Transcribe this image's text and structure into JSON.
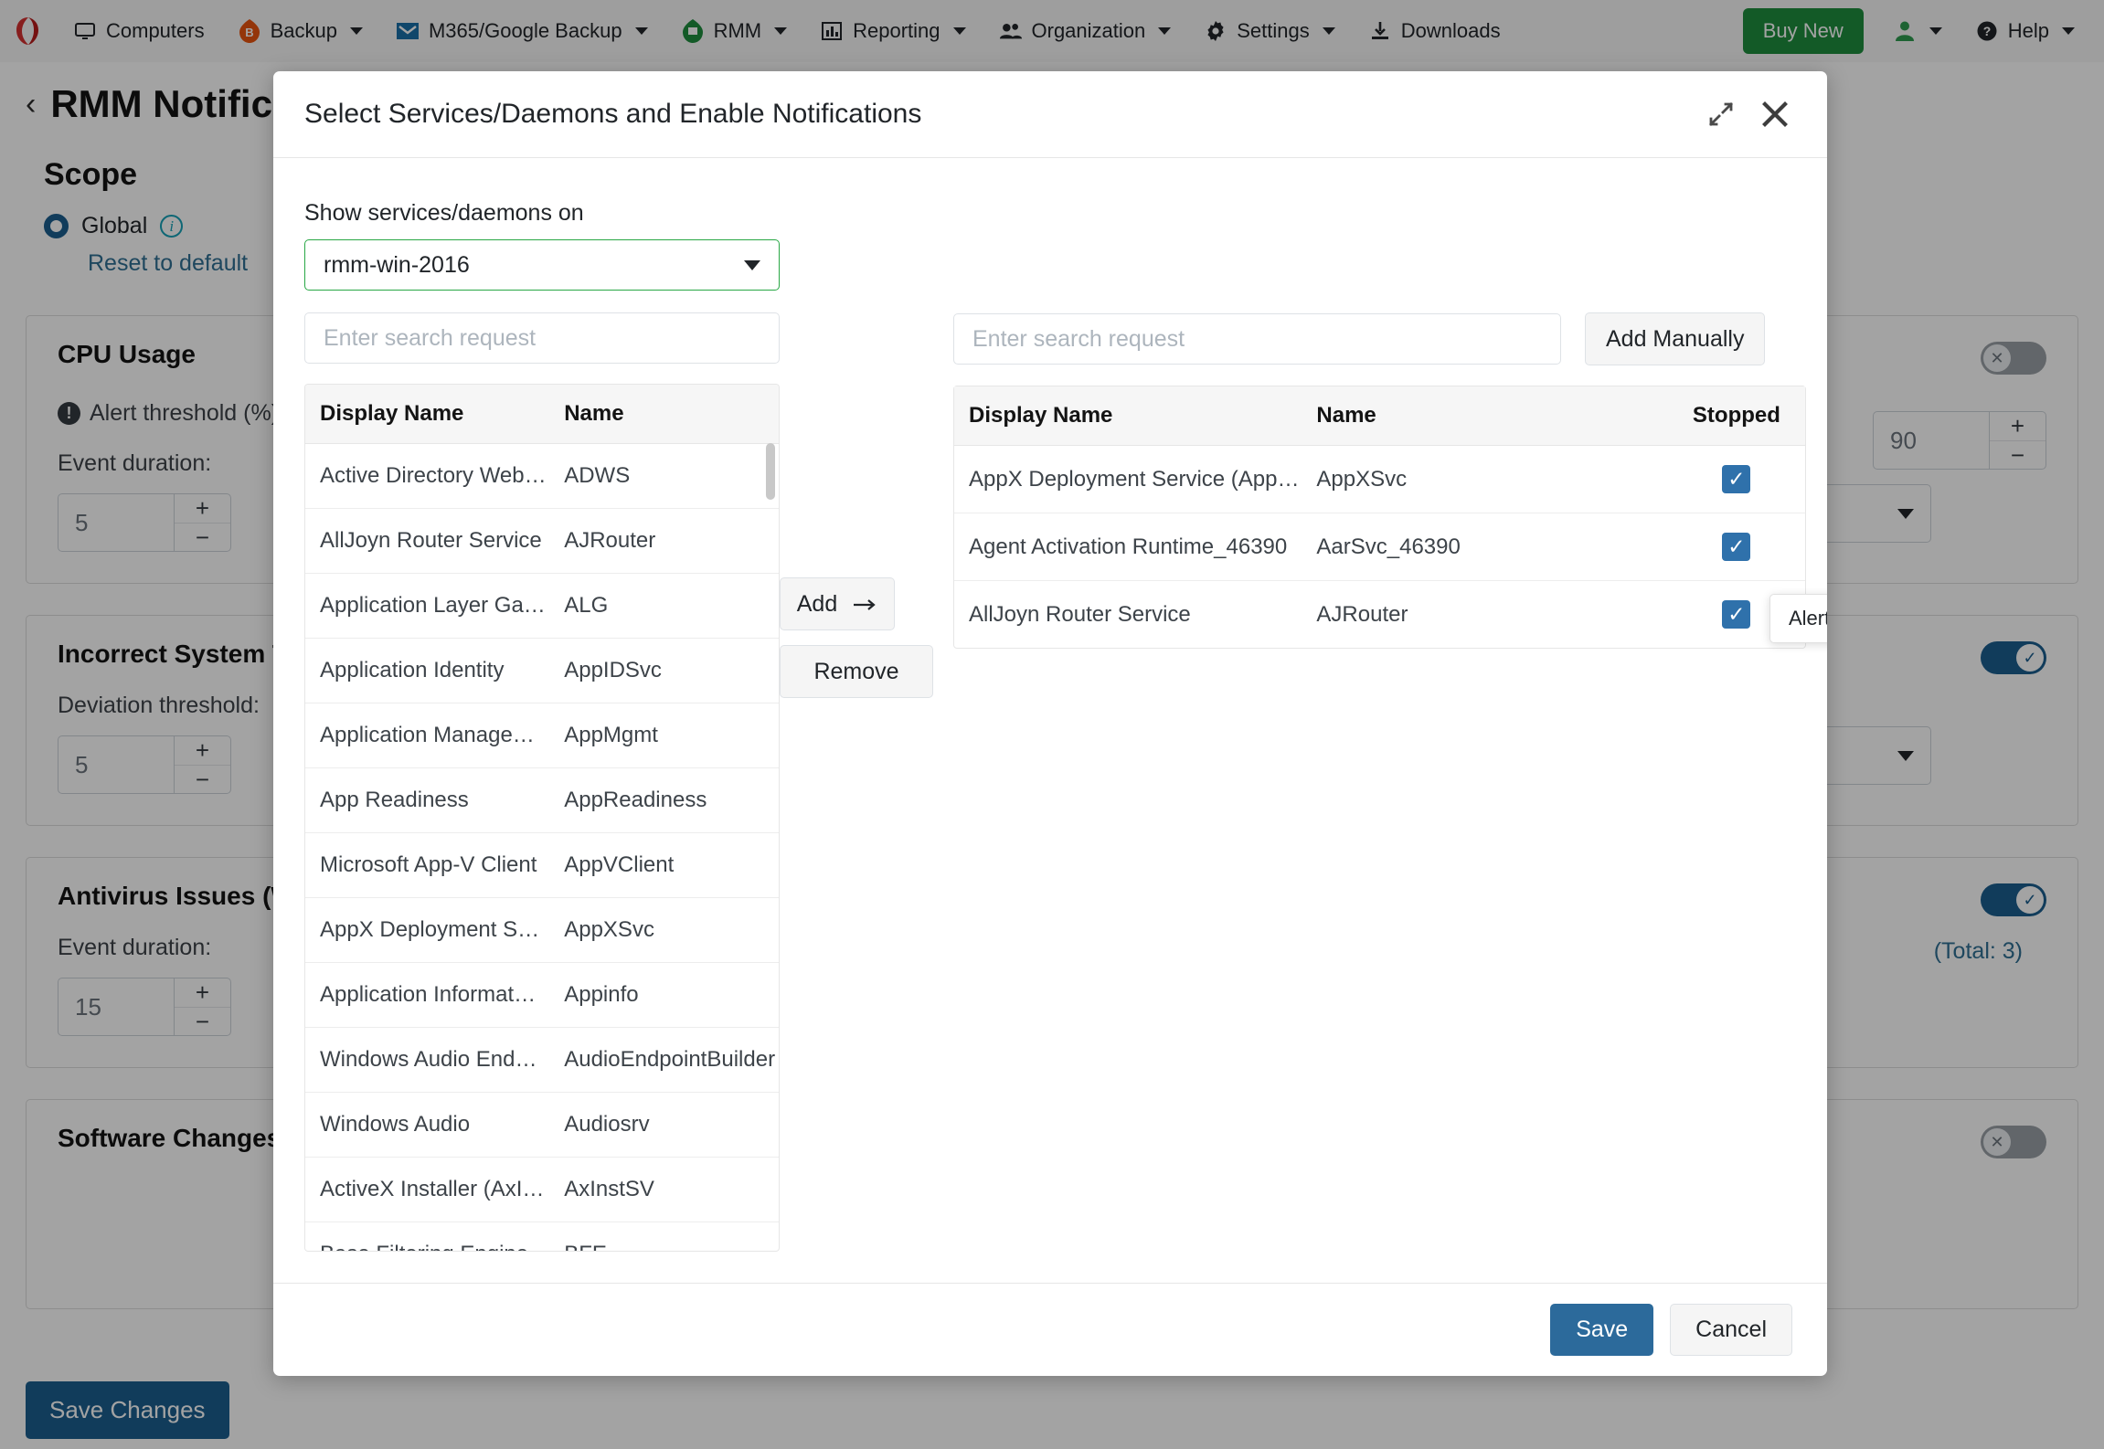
{
  "navbar": {
    "logo_icon": "crashplan-logo-icon",
    "items": [
      {
        "label": "Computers",
        "icon": "monitor-icon",
        "caret": false
      },
      {
        "label": "Backup",
        "icon": "backup-shield-icon",
        "caret": true
      },
      {
        "label": "M365/Google Backup",
        "icon": "envelope-check-icon",
        "caret": true
      },
      {
        "label": "RMM",
        "icon": "rmm-shield-icon",
        "caret": true
      },
      {
        "label": "Reporting",
        "icon": "bar-chart-icon",
        "caret": true
      },
      {
        "label": "Organization",
        "icon": "people-icon",
        "caret": true
      },
      {
        "label": "Settings",
        "icon": "gear-icon",
        "caret": true
      },
      {
        "label": "Downloads",
        "icon": "download-icon",
        "caret": false
      }
    ],
    "buy_new_label": "Buy New",
    "buy_new_color": "#1e8e3e",
    "user_icon": "user-icon",
    "help_label": "Help",
    "help_icon": "question-circle-icon"
  },
  "page": {
    "back_icon": "chevron-left-icon",
    "title": "RMM Notifications",
    "scope_heading": "Scope",
    "scope_option": "Global",
    "scope_info_icon": "info-circle-icon",
    "reset_link": "Reset to default",
    "save_changes_label": "Save Changes",
    "cards": [
      {
        "title": "CPU Usage",
        "sub_label": "Alert threshold (%):",
        "sub_icon": "exclamation-circle-icon",
        "duration_label": "Event duration:",
        "duration_value": "5",
        "threshold_value": "90",
        "toggle_state": "off"
      },
      {
        "title": "Incorrect System Time",
        "sub_label": "Deviation threshold:",
        "duration_value": "5",
        "toggle_state": "on"
      },
      {
        "title": "Antivirus Issues (Windows)",
        "duration_label": "Event duration:",
        "duration_value": "15",
        "total_label": "(Total: 3)",
        "toggle_state": "on"
      },
      {
        "title": "Software Changes",
        "toggle_state": "off"
      }
    ],
    "stepper_plus": "+",
    "stepper_minus": "−"
  },
  "modal": {
    "title": "Select Services/Daemons and Enable Notifications",
    "expand_icon": "expand-arrows-icon",
    "close_icon": "close-x-icon",
    "host_label": "Show services/daemons on",
    "host_value": "rmm-win-2016",
    "host_caret_icon": "chevron-down-icon",
    "search_placeholder": "Enter search request",
    "search_left_value": "",
    "search_right_value": "",
    "add_manually_label": "Add Manually",
    "add_label": "Add",
    "add_arrow_icon": "arrow-right-icon",
    "remove_label": "Remove",
    "tooltip_text": "Alert will be generated if service/daemon is stopped",
    "save_label": "Save",
    "cancel_label": "Cancel",
    "left_table": {
      "columns": [
        "Display Name",
        "Name"
      ],
      "rows": [
        {
          "display_name": "Active Directory Web…",
          "name": "ADWS"
        },
        {
          "display_name": "AllJoyn Router Service",
          "name": "AJRouter"
        },
        {
          "display_name": "Application Layer Ga…",
          "name": "ALG"
        },
        {
          "display_name": "Application Identity",
          "name": "AppIDSvc"
        },
        {
          "display_name": "Application Manage…",
          "name": "AppMgmt"
        },
        {
          "display_name": "App Readiness",
          "name": "AppReadiness"
        },
        {
          "display_name": "Microsoft App-V Client",
          "name": "AppVClient"
        },
        {
          "display_name": "AppX Deployment Se…",
          "name": "AppXSvc"
        },
        {
          "display_name": "Application Informat…",
          "name": "Appinfo"
        },
        {
          "display_name": "Windows Audio End…",
          "name": "AudioEndpointBuilder"
        },
        {
          "display_name": "Windows Audio",
          "name": "Audiosrv"
        },
        {
          "display_name": "ActiveX Installer (AxI…",
          "name": "AxInstSV"
        },
        {
          "display_name": "Base Filtering Engine",
          "name": "BFE"
        }
      ]
    },
    "right_table": {
      "columns": [
        "Display Name",
        "Name",
        "Stopped"
      ],
      "rows": [
        {
          "display_name": "AppX Deployment Service (AppXS…",
          "name": "AppXSvc",
          "stopped": true
        },
        {
          "display_name": "Agent Activation Runtime_46390",
          "name": "AarSvc_46390",
          "stopped": true
        },
        {
          "display_name": "AllJoyn Router Service",
          "name": "AJRouter",
          "stopped": true
        }
      ]
    },
    "checkbox_color": "#2f71ab"
  }
}
